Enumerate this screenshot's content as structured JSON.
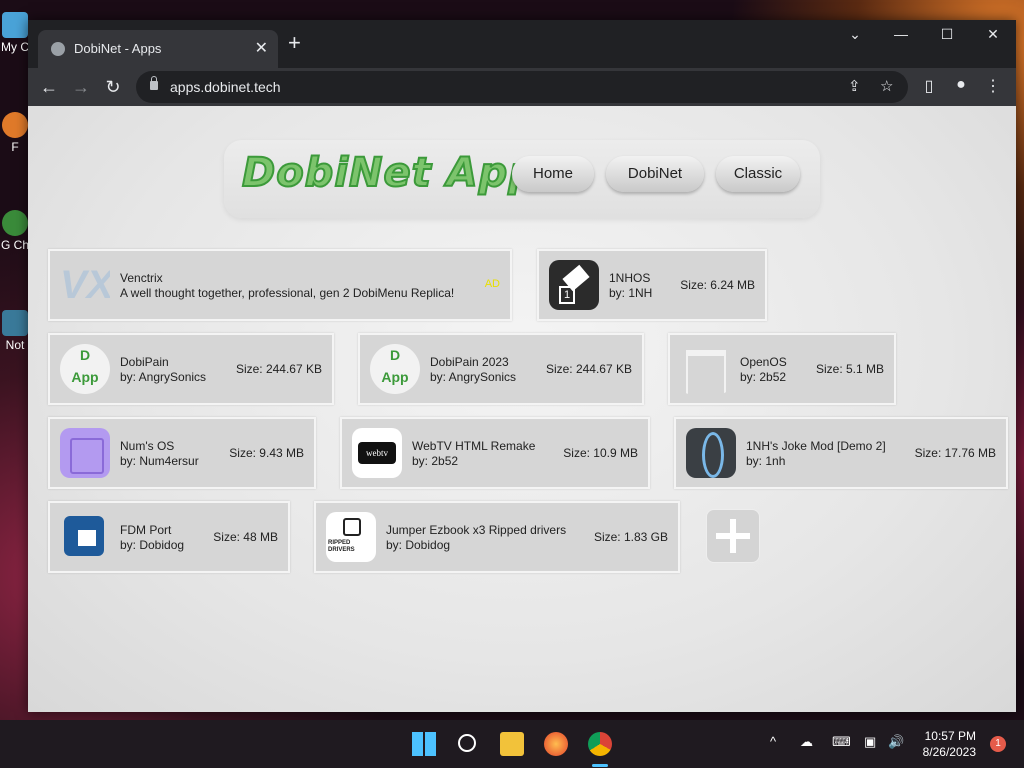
{
  "desktop": {
    "icons": [
      {
        "label": "My C",
        "color": "#4aa3d8"
      },
      {
        "label": "F",
        "color": "#e07a2a"
      },
      {
        "label": "G Ch",
        "color": "#3a8b3a"
      },
      {
        "label": "Not",
        "color": "#3a7a9a"
      }
    ]
  },
  "browser": {
    "tab_title": "DobiNet - Apps",
    "tab_close": "✕",
    "new_tab": "+",
    "url": "apps.dobinet.tech",
    "window_controls": {
      "dropdown": "⌄",
      "minimize": "—",
      "maximize": "☐",
      "close": "✕"
    },
    "nav": {
      "back": "←",
      "forward": "→",
      "reload": "↻"
    },
    "icons": {
      "share": "share-icon",
      "star": "star-icon",
      "sidepanel": "sidepanel-icon",
      "profile": "profile-icon",
      "menu": "menu-icon"
    }
  },
  "page": {
    "logo": "DobiNet Apps",
    "nav_buttons": [
      "Home",
      "DobiNet",
      "Classic"
    ],
    "featured": {
      "name": "Venctrix",
      "description": "A well thought together, professional, gen 2 DobiMenu Replica!",
      "badge": "AD",
      "icon_text": "VX"
    },
    "apps": [
      {
        "name": "1NHOS",
        "by": "by: 1NH",
        "size": "Size: 6.24 MB",
        "icon": "eraser-icon"
      },
      {
        "name": "DobiPain",
        "by": "by: AngrySonics",
        "size": "Size: 244.67 KB",
        "icon": "dobipain-icon"
      },
      {
        "name": "DobiPain 2023",
        "by": "by: AngrySonics",
        "size": "Size: 244.67 KB",
        "icon": "dobipain-icon"
      },
      {
        "name": "OpenOS",
        "by": "by: 2b52",
        "size": "Size: 5.1 MB",
        "icon": "window-icon"
      },
      {
        "name": "Num's OS",
        "by": "by: Num4ersur",
        "size": "Size: 9.43 MB",
        "icon": "num-icon"
      },
      {
        "name": "WebTV HTML Remake",
        "by": "by: 2b52",
        "size": "Size: 10.9 MB",
        "icon": "webtv-icon"
      },
      {
        "name": "1NH's Joke Mod [Demo 2]",
        "by": "by: 1nh",
        "size": "Size: 17.76 MB",
        "icon": "portal-icon"
      },
      {
        "name": "FDM Port",
        "by": "by: Dobidog",
        "size": "Size: 48 MB",
        "icon": "fdm-icon"
      },
      {
        "name": "Jumper Ezbook x3 Ripped drivers",
        "by": "by: Dobidog",
        "size": "Size: 1.83 GB",
        "icon": "jumper-icon"
      }
    ],
    "add_button": "add-app-icon",
    "webtv_text": "webtv",
    "jumper_text": "RIPPED DRIVERS"
  },
  "taskbar": {
    "time": "10:57 PM",
    "date": "8/26/2023",
    "notifications": "1",
    "tray_chevron": "^"
  }
}
